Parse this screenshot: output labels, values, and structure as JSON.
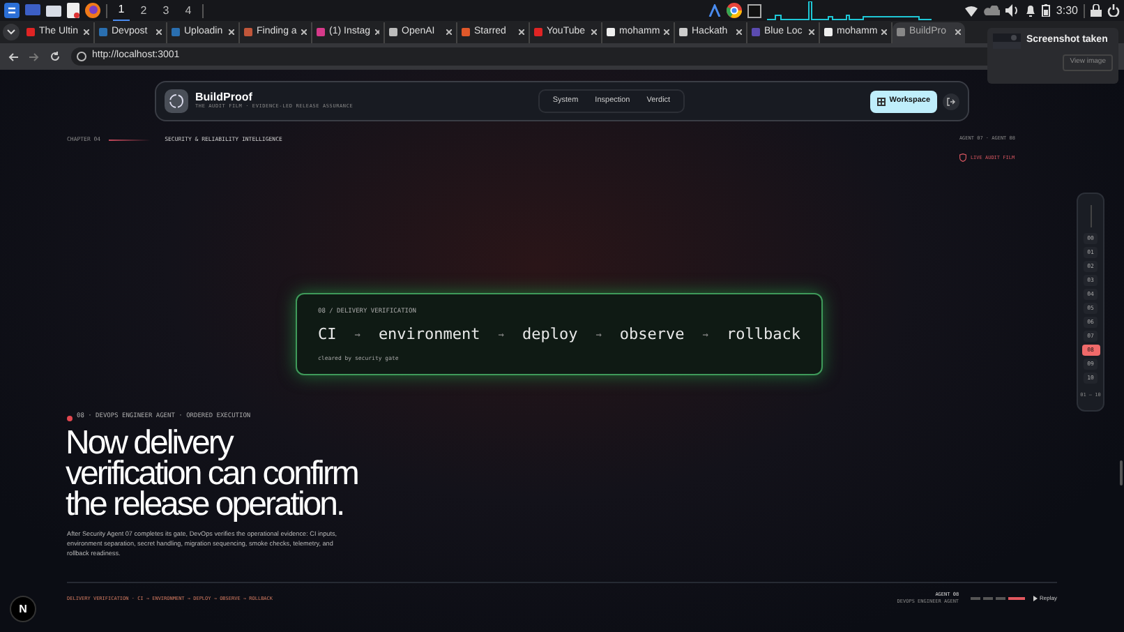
{
  "taskbar": {
    "workspaces": [
      {
        "label": "1",
        "selected": true
      },
      {
        "label": "2",
        "selected": false
      },
      {
        "label": "3",
        "selected": false
      },
      {
        "label": "4",
        "selected": false
      }
    ],
    "clock": "3:30"
  },
  "tabs": [
    {
      "label": "The Ultin",
      "color": "#e02424",
      "selected": false
    },
    {
      "label": "Devpost",
      "color": "#2a6fb0",
      "selected": false
    },
    {
      "label": "Uploadin",
      "color": "#2a6fb0",
      "selected": false
    },
    {
      "label": "Finding a",
      "color": "#c0563a",
      "selected": false
    },
    {
      "label": "(1) Instag",
      "color": "#d63a8a",
      "selected": false
    },
    {
      "label": "OpenAI",
      "color": "#bbbbbb",
      "selected": false
    },
    {
      "label": "Starred",
      "color": "#e0582a",
      "selected": false
    },
    {
      "label": "YouTube",
      "color": "#e02424",
      "selected": false
    },
    {
      "label": "mohamm",
      "color": "#eeeeee",
      "selected": false
    },
    {
      "label": "Hackath",
      "color": "#cccccc",
      "selected": false
    },
    {
      "label": "Blue Loc",
      "color": "#5b4bb0",
      "selected": false
    },
    {
      "label": "mohamm",
      "color": "#eeeeee",
      "selected": false
    },
    {
      "label": "BuildPro",
      "color": "#888888",
      "selected": true
    }
  ],
  "address": "http://localhost:3001",
  "notification": {
    "title": "Screenshot taken",
    "button": "View image"
  },
  "nav": {
    "brand": "BuildProof",
    "tagline": "THE AUDIT FILM · EVIDENCE-LED RELEASE ASSURANCE",
    "links": [
      {
        "label": "System"
      },
      {
        "label": "Inspection"
      },
      {
        "label": "Verdict"
      }
    ],
    "cta": "Workspace"
  },
  "chapter": {
    "label": "CHAPTER 04",
    "title": "SECURITY & RELIABILITY INTELLIGENCE",
    "agents": "AGENT 07 · AGENT 08",
    "live": "LIVE AUDIT FILM"
  },
  "card": {
    "eyebrow": "08 / DELIVERY VERIFICATION",
    "steps": [
      "CI",
      "environment",
      "deploy",
      "observe",
      "rollback"
    ],
    "arrow": "→",
    "footer": "cleared by security gate"
  },
  "hero": {
    "eyebrow": "08 · DEVOPS ENGINEER AGENT · ORDERED EXECUTION",
    "lines": [
      "Now delivery",
      "verification can confirm",
      "the release operation."
    ],
    "body": "After Security Agent 07 completes its gate, DevOps verifies the operational evidence: CI inputs, environment separation, secret handling, migration sequencing, smoke checks, telemetry, and rollback readiness."
  },
  "rail": {
    "items": [
      {
        "label": "00",
        "selected": false
      },
      {
        "label": "01",
        "selected": false
      },
      {
        "label": "02",
        "selected": false
      },
      {
        "label": "03",
        "selected": false
      },
      {
        "label": "04",
        "selected": false
      },
      {
        "label": "05",
        "selected": false
      },
      {
        "label": "06",
        "selected": false
      },
      {
        "label": "07",
        "selected": false
      },
      {
        "label": "08",
        "selected": true
      },
      {
        "label": "09",
        "selected": false
      },
      {
        "label": "10",
        "selected": false
      }
    ],
    "count": "01 — 10"
  },
  "footer": {
    "caption": "DELIVERY VERIFICATION · CI → ENVIRONMENT → DEPLOY → OBSERVE → ROLLBACK",
    "agent": "AGENT 08",
    "role": "DEVOPS ENGINEER AGENT",
    "segments": [
      {
        "selected": false
      },
      {
        "selected": false
      },
      {
        "selected": false
      },
      {
        "selected": true
      }
    ],
    "replay": "Replay"
  },
  "badge": "N"
}
